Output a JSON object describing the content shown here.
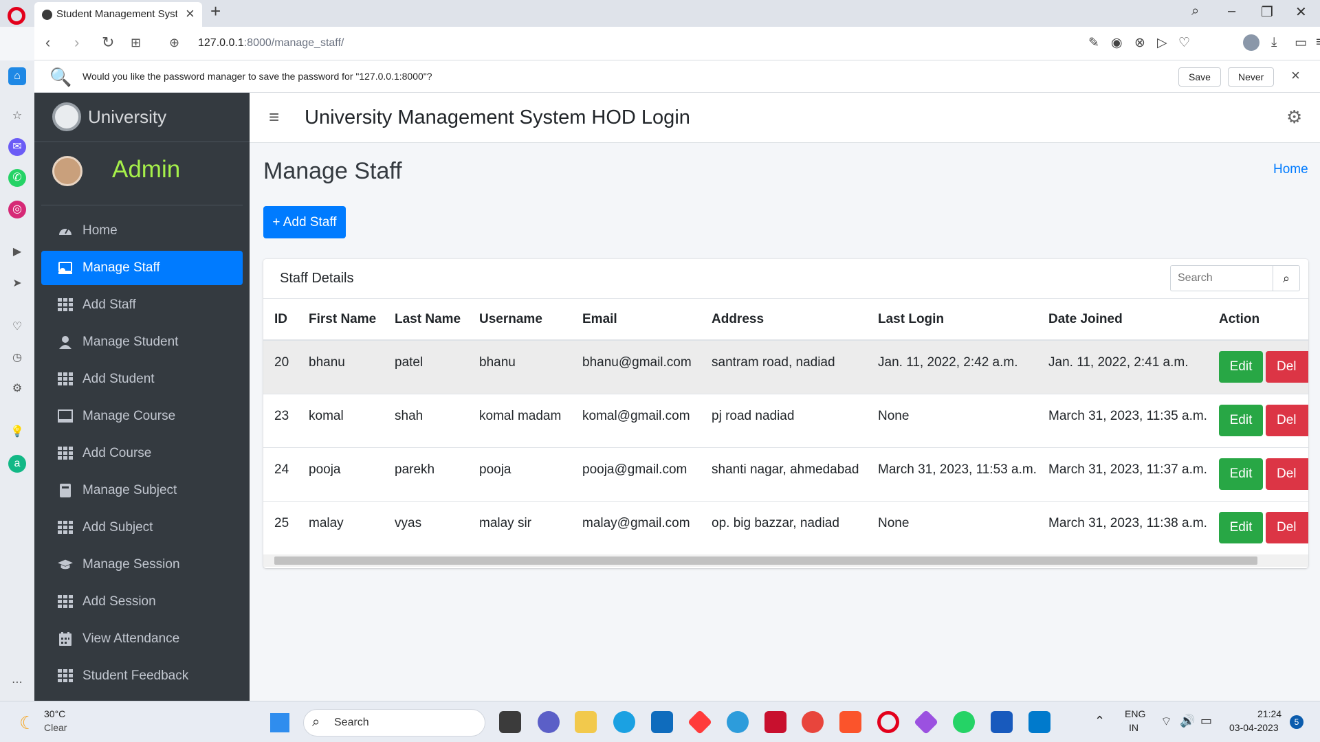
{
  "browser": {
    "tab_title": "Student Management Syste",
    "url_host": "127.0.0.1",
    "url_rest": ":8000/manage_staff/",
    "password_prompt": "Would you like the password manager to save the password for \"127.0.0.1:8000\"?",
    "save_label": "Save",
    "never_label": "Never"
  },
  "sidebar": {
    "brand": "University",
    "user": "Admin",
    "items": [
      {
        "label": "Home",
        "icon": "dashboard-icon",
        "active": false
      },
      {
        "label": "Manage Staff",
        "icon": "staff-icon",
        "active": true
      },
      {
        "label": "Add Staff",
        "icon": "grid-icon",
        "active": false
      },
      {
        "label": "Manage Student",
        "icon": "student-icon",
        "active": false
      },
      {
        "label": "Add Student",
        "icon": "grid-icon",
        "active": false
      },
      {
        "label": "Manage Course",
        "icon": "monitor-icon",
        "active": false
      },
      {
        "label": "Add Course",
        "icon": "grid-icon",
        "active": false
      },
      {
        "label": "Manage Subject",
        "icon": "book-icon",
        "active": false
      },
      {
        "label": "Add Subject",
        "icon": "grid-icon",
        "active": false
      },
      {
        "label": "Manage Session",
        "icon": "graduation-cap-icon",
        "active": false
      },
      {
        "label": "Add Session",
        "icon": "grid-icon",
        "active": false
      },
      {
        "label": "View Attendance",
        "icon": "calendar-icon",
        "active": false
      },
      {
        "label": "Student Feedback",
        "icon": "grid-icon",
        "active": false
      }
    ]
  },
  "header": {
    "title": "University Management System HOD Login"
  },
  "page": {
    "title": "Manage Staff",
    "breadcrumb": "Home",
    "add_button": "+ Add Staff"
  },
  "card": {
    "title": "Staff Details",
    "search_placeholder": "Search",
    "columns": [
      "ID",
      "First Name",
      "Last Name",
      "Username",
      "Email",
      "Address",
      "Last Login",
      "Date Joined",
      "Action"
    ],
    "rows": [
      [
        "20",
        "bhanu",
        "patel",
        "bhanu",
        "bhanu@gmail.com",
        "santram road, nadiad",
        "Jan. 11, 2022, 2:42 a.m.",
        "Jan. 11, 2022, 2:41 a.m."
      ],
      [
        "23",
        "komal",
        "shah",
        "komal madam",
        "komal@gmail.com",
        "pj road nadiad",
        "None",
        "March 31, 2023, 11:35 a.m."
      ],
      [
        "24",
        "pooja",
        "parekh",
        "pooja",
        "pooja@gmail.com",
        "shanti nagar, ahmedabad",
        "March 31, 2023, 11:53 a.m.",
        "March 31, 2023, 11:37 a.m."
      ],
      [
        "25",
        "malay",
        "vyas",
        "malay sir",
        "malay@gmail.com",
        "op. big bazzar, nadiad",
        "None",
        "March 31, 2023, 11:38 a.m."
      ]
    ],
    "edit_label": "Edit",
    "delete_label": "Del"
  },
  "taskbar": {
    "weather_temp": "30°C",
    "weather_desc": "Clear",
    "search_label": "Search",
    "lang_top": "ENG",
    "lang_bottom": "IN",
    "time": "21:24",
    "date": "03-04-2023",
    "notifications": "5"
  },
  "colors": {
    "primary": "#007bff",
    "sidebar_bg": "#343a40",
    "success": "#28a745",
    "danger": "#dc3545",
    "admin_name": "#a6f04a"
  }
}
